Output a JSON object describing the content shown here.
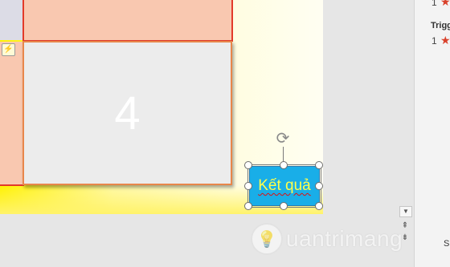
{
  "slide": {
    "box_number": "4",
    "selected_shape_text": "Kết quả",
    "animation_tag_symbol": "⚡",
    "rotate_symbol": "⟳"
  },
  "scrollbar": {
    "down_arrow": "▼",
    "prev_slide": "⇞",
    "next_slide": "⇟"
  },
  "animation_pane": {
    "item1_number": "1",
    "trigger_label": "Trigg",
    "item2_number": "1",
    "star_symbol": "★",
    "bottom_label": "S"
  },
  "watermark": {
    "logo_symbol": "💡",
    "text": "uantrimang"
  },
  "colors": {
    "slide_gradient_start": "#fff200",
    "shape_fill": "#19aee8",
    "shape_text": "#ffff4a",
    "box_border_red": "#e23a2a",
    "box_border_orange": "#e8864a",
    "box_salmon": "#f9c8b0",
    "star": "#d9412b"
  }
}
